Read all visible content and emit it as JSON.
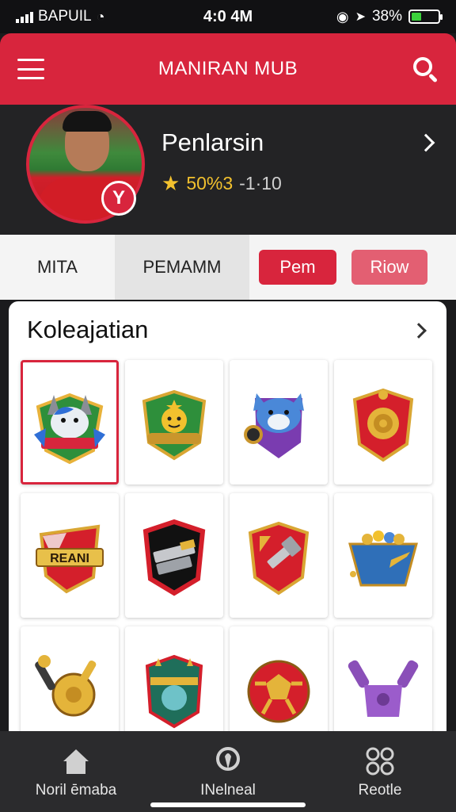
{
  "status_bar": {
    "carrier": "BAPUIL",
    "time": "4:0 4M",
    "battery": "38%",
    "battery_level": 0.38
  },
  "app_bar": {
    "title": "MANIRAN MUB",
    "menu_icon": "hamburger-icon",
    "search_icon": "search-icon"
  },
  "profile": {
    "name": "Penlarsin",
    "stats_highlight": "50%3",
    "stats_rest": "-1·10",
    "badge_letter": "Y"
  },
  "tabs": {
    "tab1": "MITA",
    "tab2": "PEMAMM",
    "button1": "Pem",
    "button2": "Riow"
  },
  "collection": {
    "title": "Koleajatian",
    "badges": [
      {
        "banner": "",
        "label": "wolf-mascot-crest"
      },
      {
        "banner": "",
        "label": "green-star-crest"
      },
      {
        "banner": "",
        "label": "blue-cat-crest"
      },
      {
        "banner": "",
        "label": "red-gold-crest"
      },
      {
        "banner": "REANI",
        "label": "reani-crest"
      },
      {
        "banner": "",
        "label": "black-hammer-crest"
      },
      {
        "banner": "",
        "label": "red-hammer-crest"
      },
      {
        "banner": "",
        "label": "treasure-bucket"
      },
      {
        "banner": "",
        "label": "golden-key-ball"
      },
      {
        "banner": "",
        "label": "teal-crest"
      },
      {
        "banner": "",
        "label": "red-gold-ball"
      },
      {
        "banner": "",
        "label": "purple-bottle"
      }
    ]
  },
  "bottom_nav": {
    "items": [
      {
        "label": "Noril ēmaba",
        "icon": "home-icon"
      },
      {
        "label": "INelneal",
        "icon": "location-icon"
      },
      {
        "label": "Reotle",
        "icon": "grid-icon"
      }
    ]
  },
  "colors": {
    "accent": "#d8253d",
    "dark": "#232325",
    "gold": "#f2c12e"
  }
}
